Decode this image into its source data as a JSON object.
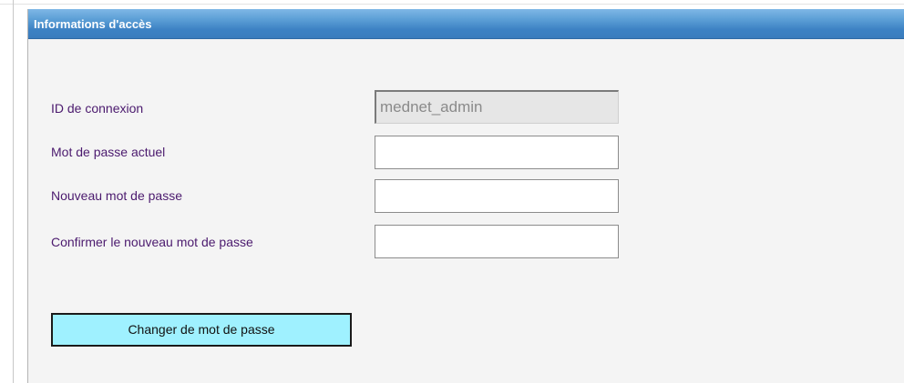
{
  "section": {
    "title": "Informations d'accès"
  },
  "form": {
    "login_id": {
      "label": "ID de connexion",
      "value": "mednet_admin"
    },
    "current_password": {
      "label": "Mot de passe actuel",
      "value": ""
    },
    "new_password": {
      "label": "Nouveau mot de passe",
      "value": ""
    },
    "confirm_password": {
      "label": "Confirmer le nouveau mot de passe",
      "value": ""
    },
    "submit_label": "Changer de mot de passe"
  },
  "colors": {
    "header_gradient_top": "#7fb7e6",
    "header_gradient_bottom": "#3a7cbd",
    "label_text": "#4b1a6e",
    "button_fill": "#9ff1ff",
    "panel_background": "#f4f4f4"
  }
}
